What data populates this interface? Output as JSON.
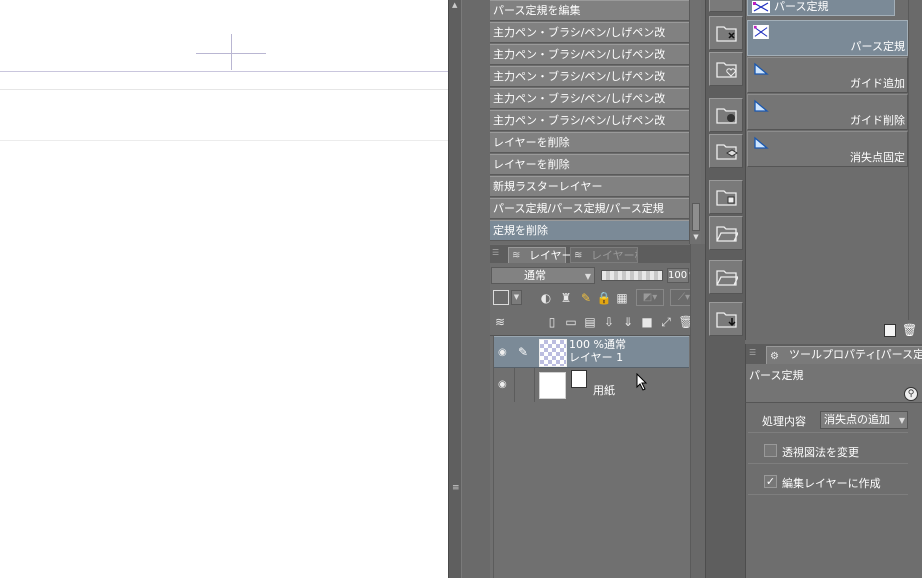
{
  "history": {
    "items": [
      {
        "label": "パース定規を編集",
        "selected": false
      },
      {
        "label": "主力ペン・ブラシ/ペン/しげペン改",
        "selected": false
      },
      {
        "label": "主力ペン・ブラシ/ペン/しげペン改",
        "selected": false
      },
      {
        "label": "主力ペン・ブラシ/ペン/しげペン改",
        "selected": false
      },
      {
        "label": "主力ペン・ブラシ/ペン/しげペン改",
        "selected": false
      },
      {
        "label": "主力ペン・ブラシ/ペン/しげペン改",
        "selected": false
      },
      {
        "label": "レイヤーを削除",
        "selected": false
      },
      {
        "label": "レイヤーを削除",
        "selected": false
      },
      {
        "label": "新規ラスターレイヤー",
        "selected": false
      },
      {
        "label": "パース定規/パース定規/パース定規",
        "selected": false
      },
      {
        "label": "定規を削除",
        "selected": true
      }
    ]
  },
  "layer_panel": {
    "tabs": [
      {
        "label": "レイヤー",
        "active": true
      },
      {
        "label": "レイヤー検索",
        "active": false
      }
    ],
    "blend_mode": "通常",
    "opacity": "100",
    "layers": [
      {
        "line1": "100 %通常",
        "line2": "レイヤー 1",
        "selected": true
      },
      {
        "name": "用紙",
        "selected": false
      }
    ]
  },
  "sub_tool": {
    "group_title": "パース定規",
    "items": [
      {
        "label": "パース定規",
        "selected": true
      },
      {
        "label": "ガイド追加",
        "selected": false
      },
      {
        "label": "ガイド削除",
        "selected": false
      },
      {
        "label": "消失点固定",
        "selected": false
      }
    ]
  },
  "tool_property": {
    "tab_label": "ツールプロパティ[パース定規]",
    "title": "パース定規",
    "process_label": "処理内容",
    "process_value": "消失点の追加",
    "options": [
      {
        "label": "透視図法を変更",
        "checked": false
      },
      {
        "label": "編集レイヤーに作成",
        "checked": true
      }
    ]
  },
  "colors": {
    "selection": "#7b8a97",
    "panel": "#6e6e6e",
    "canvas": "#ffffff",
    "guide_line": "#c9c6dd"
  }
}
